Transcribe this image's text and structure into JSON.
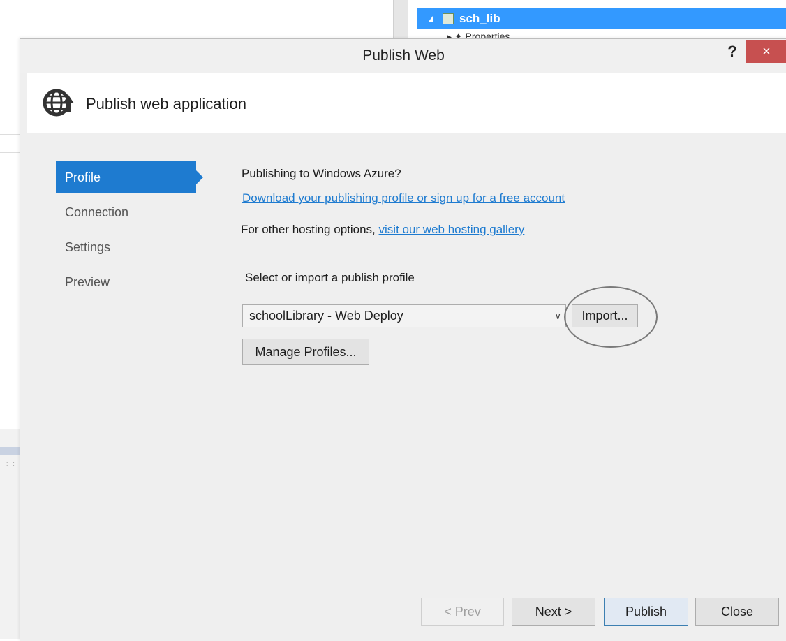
{
  "background": {
    "tree_selected_item": "sch_lib",
    "tree_next_item": "Properties"
  },
  "dialog": {
    "title": "Publish Web",
    "help_label": "?",
    "close_label": "×",
    "header_title": "Publish web application",
    "header_icon": "globe-upload-icon"
  },
  "nav": {
    "items": [
      {
        "label": "Profile",
        "active": true
      },
      {
        "label": "Connection",
        "active": false
      },
      {
        "label": "Settings",
        "active": false
      },
      {
        "label": "Preview",
        "active": false
      }
    ]
  },
  "main": {
    "azure_question": "Publishing to Windows Azure?",
    "download_link": "Download your publishing profile or sign up for a free account",
    "other_hosting_prefix": "For other hosting options, ",
    "gallery_link": "visit our web hosting gallery",
    "select_label": "Select or import a publish profile",
    "profile_selected": "schoolLibrary - Web Deploy",
    "import_label": "Import...",
    "manage_label": "Manage Profiles..."
  },
  "footer": {
    "prev_label": "< Prev",
    "next_label": "Next >",
    "publish_label": "Publish",
    "close_label": "Close"
  },
  "colors": {
    "accent": "#1e7bd0",
    "close_button": "#c75050",
    "tree_highlight": "#3399ff"
  }
}
